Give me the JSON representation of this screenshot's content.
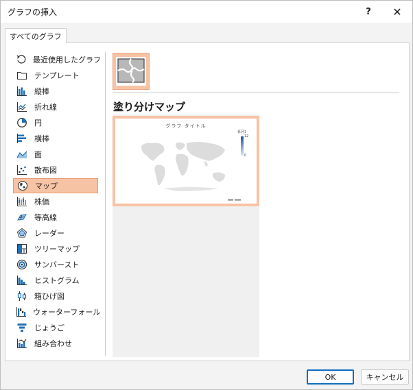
{
  "window": {
    "title": "グラフの挿入",
    "help_label": "?",
    "close_label": "✕"
  },
  "tabs": [
    {
      "label": "すべてのグラフ",
      "active": true
    }
  ],
  "sidebar": {
    "items": [
      {
        "label": "最近使用したグラフ",
        "icon": "recent-icon"
      },
      {
        "label": "テンプレート",
        "icon": "folder-icon"
      },
      {
        "label": "縦棒",
        "icon": "column-chart-icon"
      },
      {
        "label": "折れ線",
        "icon": "line-chart-icon"
      },
      {
        "label": "円",
        "icon": "pie-chart-icon"
      },
      {
        "label": "横棒",
        "icon": "bar-chart-icon"
      },
      {
        "label": "面",
        "icon": "area-chart-icon"
      },
      {
        "label": "散布図",
        "icon": "scatter-chart-icon"
      },
      {
        "label": "マップ",
        "icon": "map-chart-icon",
        "selected": true
      },
      {
        "label": "株価",
        "icon": "stock-chart-icon"
      },
      {
        "label": "等高線",
        "icon": "surface-chart-icon"
      },
      {
        "label": "レーダー",
        "icon": "radar-chart-icon"
      },
      {
        "label": "ツリーマップ",
        "icon": "treemap-chart-icon"
      },
      {
        "label": "サンバースト",
        "icon": "sunburst-chart-icon"
      },
      {
        "label": "ヒストグラム",
        "icon": "histogram-chart-icon"
      },
      {
        "label": "箱ひげ図",
        "icon": "boxplot-chart-icon"
      },
      {
        "label": "ウォーターフォール",
        "icon": "waterfall-chart-icon"
      },
      {
        "label": "じょうご",
        "icon": "funnel-chart-icon"
      },
      {
        "label": "組み合わせ",
        "icon": "combo-chart-icon"
      }
    ]
  },
  "main": {
    "chart_type_title": "塗り分けマップ",
    "preview": {
      "title": "グラフ タイトル",
      "legend_title": "系列1",
      "legend_max": "12",
      "legend_min": "0"
    }
  },
  "colors": {
    "selection": "#f7c3a5",
    "selection_border": "#e59a73",
    "accent": "#0f6cbd",
    "map_gray": "#dcdcdc"
  },
  "footer": {
    "ok_label": "OK",
    "cancel_label": "キャンセル"
  }
}
